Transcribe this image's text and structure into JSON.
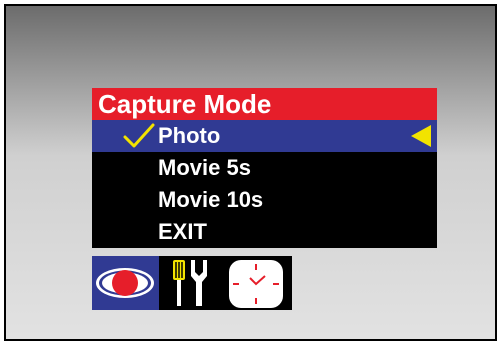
{
  "menu": {
    "title": "Capture Mode",
    "items": [
      {
        "label": "Photo",
        "selected": true
      },
      {
        "label": "Movie 5s",
        "selected": false
      },
      {
        "label": "Movie 10s",
        "selected": false
      },
      {
        "label": "EXIT",
        "selected": false
      }
    ]
  },
  "tabs": [
    {
      "icon": "eye-icon",
      "active": true
    },
    {
      "icon": "tools-icon",
      "active": false
    },
    {
      "icon": "clock-icon",
      "active": false
    }
  ],
  "colors": {
    "title_bg": "#e61e2a",
    "selection_bg": "#303a93",
    "accent": "#f2e300",
    "menu_bg": "#000000"
  }
}
